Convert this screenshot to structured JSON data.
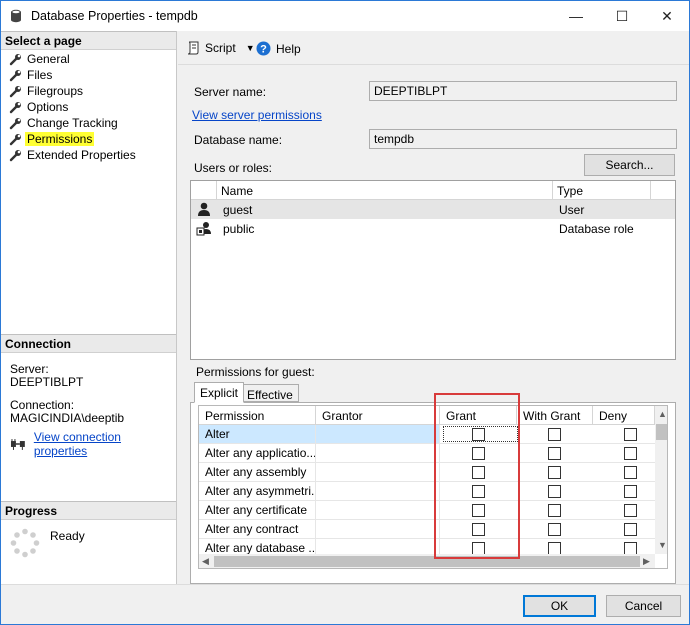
{
  "window": {
    "title": "Database Properties - tempdb",
    "minimize": "—",
    "maximize": "☐",
    "close": "✕"
  },
  "left": {
    "select_page_header": "Select a page",
    "pages": [
      {
        "label": "General"
      },
      {
        "label": "Files"
      },
      {
        "label": "Filegroups"
      },
      {
        "label": "Options"
      },
      {
        "label": "Change Tracking"
      },
      {
        "label": "Permissions",
        "selected": true
      },
      {
        "label": "Extended Properties"
      }
    ],
    "connection_header": "Connection",
    "server_label": "Server:",
    "server_value": "DEEPTIBLPT",
    "connection_label": "Connection:",
    "connection_value": "MAGICINDIA\\deeptib",
    "view_connection_link": "View connection properties",
    "progress_header": "Progress",
    "progress_status": "Ready"
  },
  "toolbar": {
    "script_label": "Script",
    "help_label": "Help"
  },
  "form": {
    "server_name_label": "Server name:",
    "server_name_value": "DEEPTIBLPT",
    "view_server_permissions_link": "View server permissions",
    "database_name_label": "Database name:",
    "database_name_value": "tempdb",
    "users_or_roles_label": "Users or roles:",
    "search_button": "Search..."
  },
  "users_grid": {
    "columns": [
      "Name",
      "Type"
    ],
    "rows": [
      {
        "name": "guest",
        "type": "User",
        "selected": true
      },
      {
        "name": "public",
        "type": "Database role"
      }
    ]
  },
  "permissions": {
    "label": "Permissions for guest:",
    "tabs": [
      "Explicit",
      "Effective"
    ],
    "active_tab": "Explicit",
    "columns": [
      "Permission",
      "Grantor",
      "Grant",
      "With Grant",
      "Deny"
    ],
    "rows": [
      {
        "permission": "Alter",
        "grantor": "",
        "grant": false,
        "with_grant": false,
        "deny": false,
        "selected": true
      },
      {
        "permission": "Alter any applicatio...",
        "grantor": "",
        "grant": false,
        "with_grant": false,
        "deny": false
      },
      {
        "permission": "Alter any assembly",
        "grantor": "",
        "grant": false,
        "with_grant": false,
        "deny": false
      },
      {
        "permission": "Alter any asymmetri...",
        "grantor": "",
        "grant": false,
        "with_grant": false,
        "deny": false
      },
      {
        "permission": "Alter any certificate",
        "grantor": "",
        "grant": false,
        "with_grant": false,
        "deny": false
      },
      {
        "permission": "Alter any contract",
        "grantor": "",
        "grant": false,
        "with_grant": false,
        "deny": false
      },
      {
        "permission": "Alter any database ...",
        "grantor": "",
        "grant": false,
        "with_grant": false,
        "deny": false
      }
    ]
  },
  "buttons": {
    "ok": "OK",
    "cancel": "Cancel"
  },
  "colors": {
    "selected_page_highlight": "#ffff33",
    "link": "#0645c8",
    "annotation_box": "#d83b3b",
    "row_selection": "#cce8ff"
  }
}
